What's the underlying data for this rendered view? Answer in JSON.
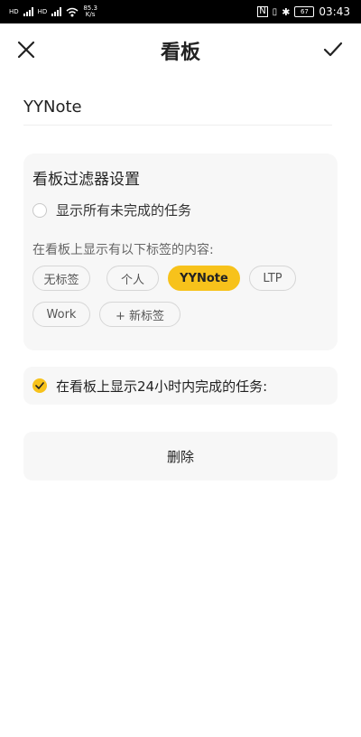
{
  "status_bar": {
    "network_label": "HD",
    "net_speed_value": "85.3",
    "net_speed_unit": "K/s",
    "battery": "67",
    "time": "03:43"
  },
  "header": {
    "title": "看板"
  },
  "board_name": {
    "value": "YYNote"
  },
  "filter": {
    "title": "看板过滤器设置",
    "show_all_label": "显示所有未完成的任务",
    "show_all_checked": false,
    "tags_label": "在看板上显示有以下标签的内容:",
    "chips": [
      "无标签",
      "个人",
      "YYNote",
      "LTP",
      "Work",
      "+ 新标签"
    ],
    "selected_chip": "YYNote"
  },
  "show_24h": {
    "label": "在看板上显示24小时内完成的任务:",
    "checked": true
  },
  "delete_label": "删除",
  "colors": {
    "accent": "#f7c21b",
    "card_bg": "#f7f7f7"
  }
}
